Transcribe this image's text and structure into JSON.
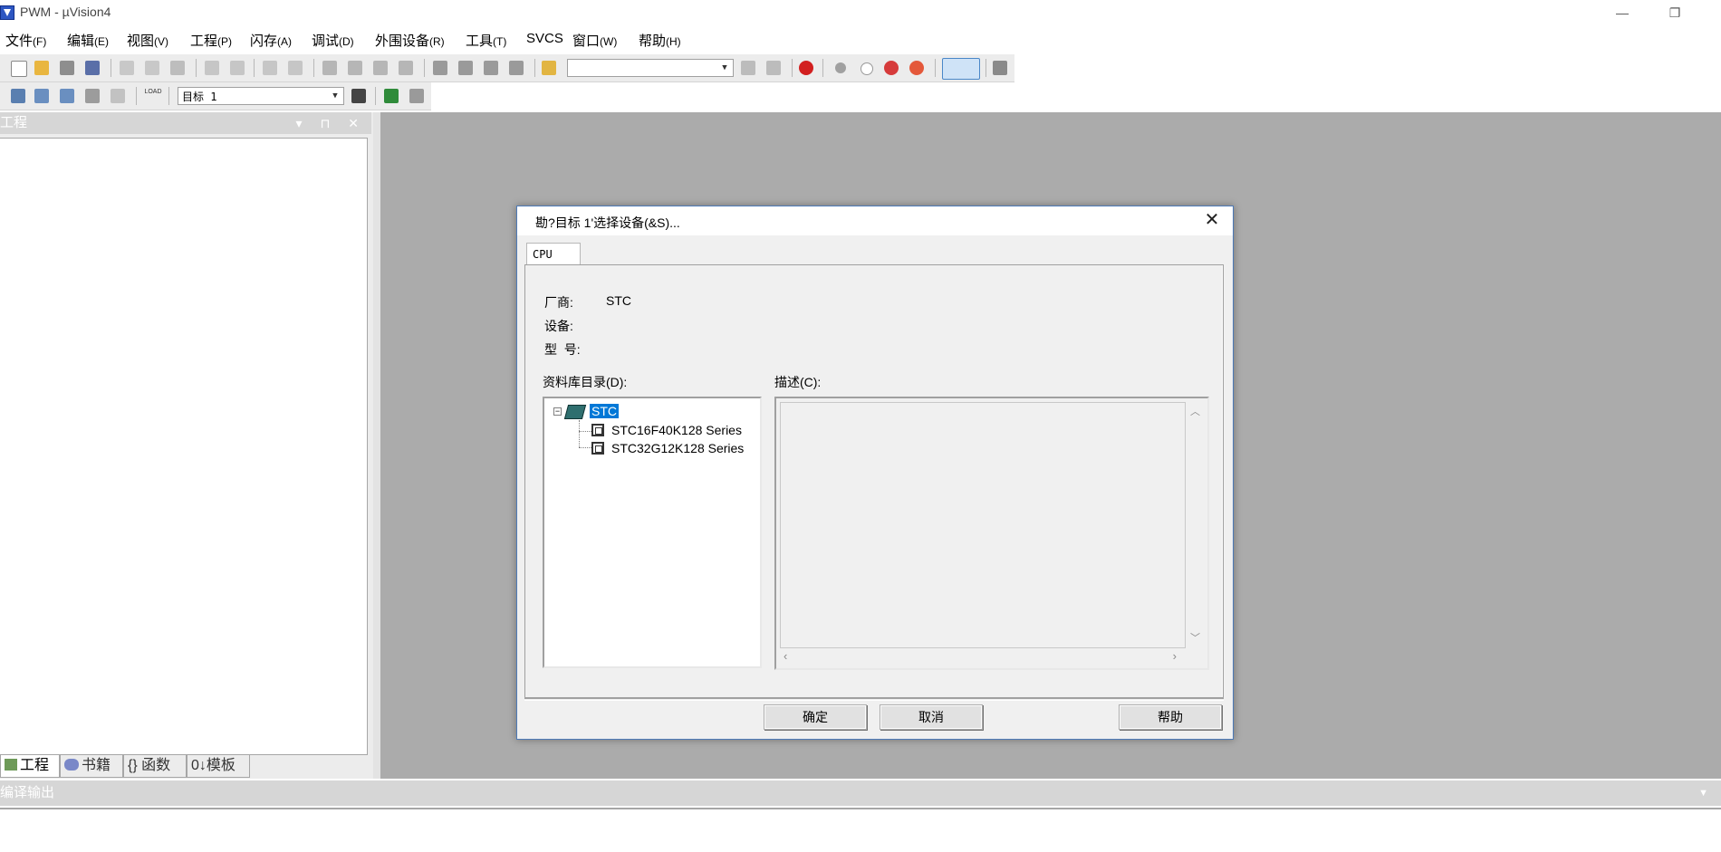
{
  "window": {
    "title": "PWM  - µVision4",
    "minimize_glyph": "—",
    "restore_glyph": "❐"
  },
  "menubar": {
    "items": [
      {
        "label": "文件",
        "key": "(F)"
      },
      {
        "label": "编辑",
        "key": "(E)"
      },
      {
        "label": "视图",
        "key": "(V)"
      },
      {
        "label": "工程",
        "key": "(P)"
      },
      {
        "label": "闪存",
        "key": "(A)"
      },
      {
        "label": "调试",
        "key": "(D)"
      },
      {
        "label": "外围设备",
        "key": "(R)"
      },
      {
        "label": "工具",
        "key": "(T)"
      },
      {
        "label": "SVCS",
        "key": ""
      },
      {
        "label": "窗口",
        "key": "(W)"
      },
      {
        "label": "帮助",
        "key": "(H)"
      }
    ]
  },
  "toolbar2": {
    "target_label": "目标 1",
    "logo_label": "LOAD"
  },
  "project_panel": {
    "title": "工程",
    "header_buttons": "▾ ⊓ ✕",
    "tabs": [
      {
        "label": "工程",
        "icon": "project-icon"
      },
      {
        "label": "书籍",
        "icon": "books-icon"
      },
      {
        "label": "函数",
        "icon": "functions-icon",
        "prefix": "{}"
      },
      {
        "label": "模板",
        "icon": "templates-icon",
        "prefix": "0↓"
      }
    ]
  },
  "output_panel": {
    "title": "编译输出"
  },
  "dialog": {
    "title": "勘?目标 1'选择设备(&S)...",
    "tab": "CPU",
    "vendor_label": "厂商:",
    "vendor_value": "STC",
    "device_label": "设备:",
    "device_value": "",
    "model_label": "型  号:",
    "model_value": "",
    "database_label": "资料库目录(D):",
    "description_label": "描述(C):",
    "tree": {
      "root": "STC",
      "children": [
        "STC16F40K128 Series",
        "STC32G12K128 Series"
      ]
    },
    "buttons": {
      "ok": "确定",
      "cancel": "取消",
      "help": "帮助"
    },
    "expander_glyph": "−"
  },
  "colors": {
    "workspace": "#ababab",
    "selection": "#0078d7",
    "panel_header": "#d6d6d6"
  }
}
